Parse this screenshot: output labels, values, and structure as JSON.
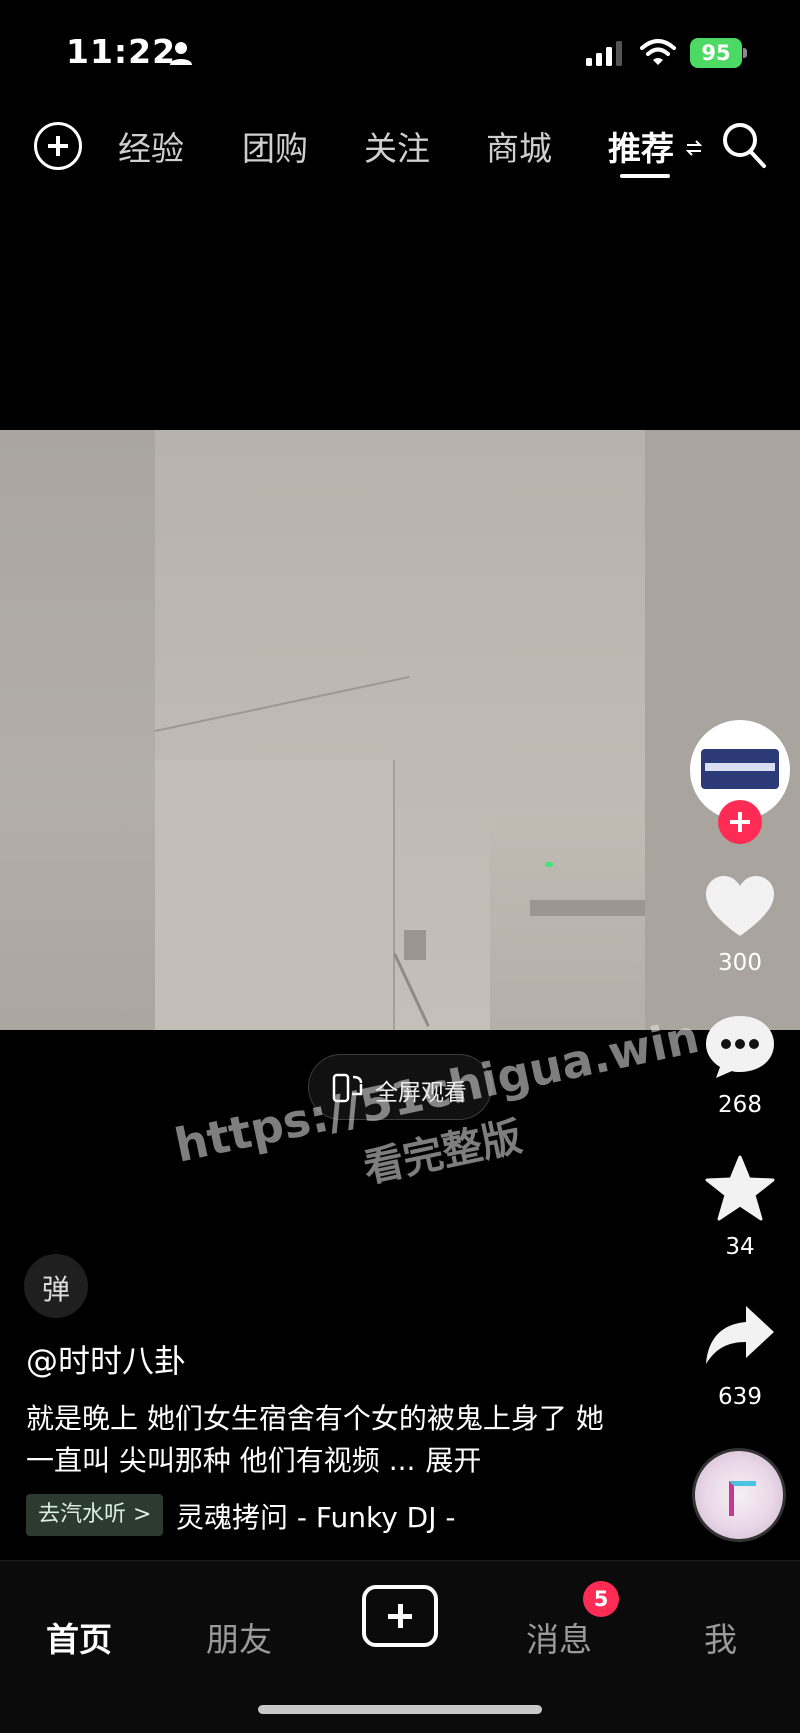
{
  "status_bar": {
    "time": "11:22",
    "battery": "95"
  },
  "top_nav": {
    "tabs": [
      {
        "label": "经验"
      },
      {
        "label": "团购"
      },
      {
        "label": "关注"
      },
      {
        "label": "商城"
      },
      {
        "label": "推荐",
        "active": true
      }
    ]
  },
  "video": {
    "fullscreen_label": "全屏观看"
  },
  "watermark": {
    "line1": "https://51chigua.win",
    "line2": "看完整版"
  },
  "danmu": {
    "label": "弹"
  },
  "post": {
    "author": "@时时八卦",
    "description": "就是晚上 她们女生宿舍有个女的被鬼上身了 她一直叫 尖叫那种 他们有视频 ...",
    "expand": "展开",
    "music_tag": "去汽水听 >",
    "music_title": "灵魂拷问 - Funky DJ -"
  },
  "actions": {
    "likes": "300",
    "comments": "268",
    "favorites": "34",
    "shares": "639"
  },
  "bottom_nav": {
    "home": "首页",
    "friends": "朋友",
    "messages": "消息",
    "messages_badge": "5",
    "me": "我"
  },
  "colors": {
    "accent": "#fe2c55",
    "battery": "#4cd964",
    "background": "#000000"
  }
}
